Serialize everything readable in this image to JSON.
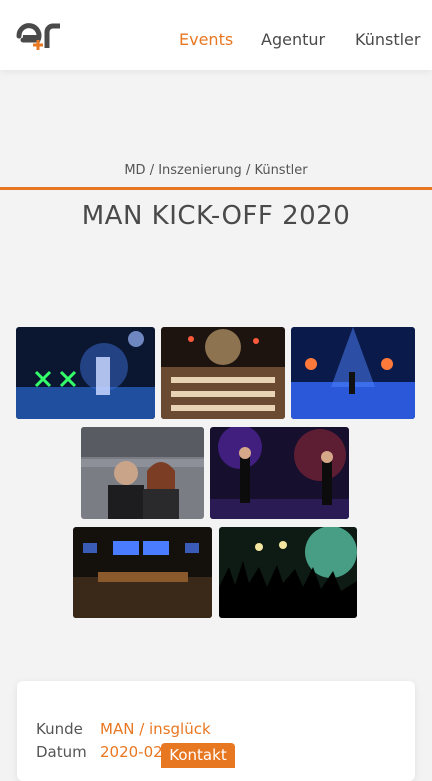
{
  "header": {
    "logo_text": "e+r",
    "nav": [
      {
        "label": "Events",
        "active": true
      },
      {
        "label": "Agentur",
        "active": false
      },
      {
        "label": "Künstler",
        "active": false
      }
    ]
  },
  "breadcrumb": "MD / Inszenierung / Künstler",
  "page_title": "MAN KICK-OFF 2020",
  "gallery": {
    "images": [
      "stage-performance-laser-light",
      "banquet-hall-dinner",
      "stage-blue-light-performer",
      "two-presenters-in-seats",
      "singers-on-stage-red-blue",
      "auditorium-stage-screens",
      "crowd-hands-raised-concert"
    ]
  },
  "details": {
    "rows": [
      {
        "label": "Kunde",
        "value": "MAN / insglück"
      },
      {
        "label": "Datum",
        "value": "2020-02"
      }
    ]
  },
  "contact_button": "Kontakt",
  "colors": {
    "accent": "#e87722",
    "background": "#f3f3f3",
    "card": "#ffffff"
  }
}
